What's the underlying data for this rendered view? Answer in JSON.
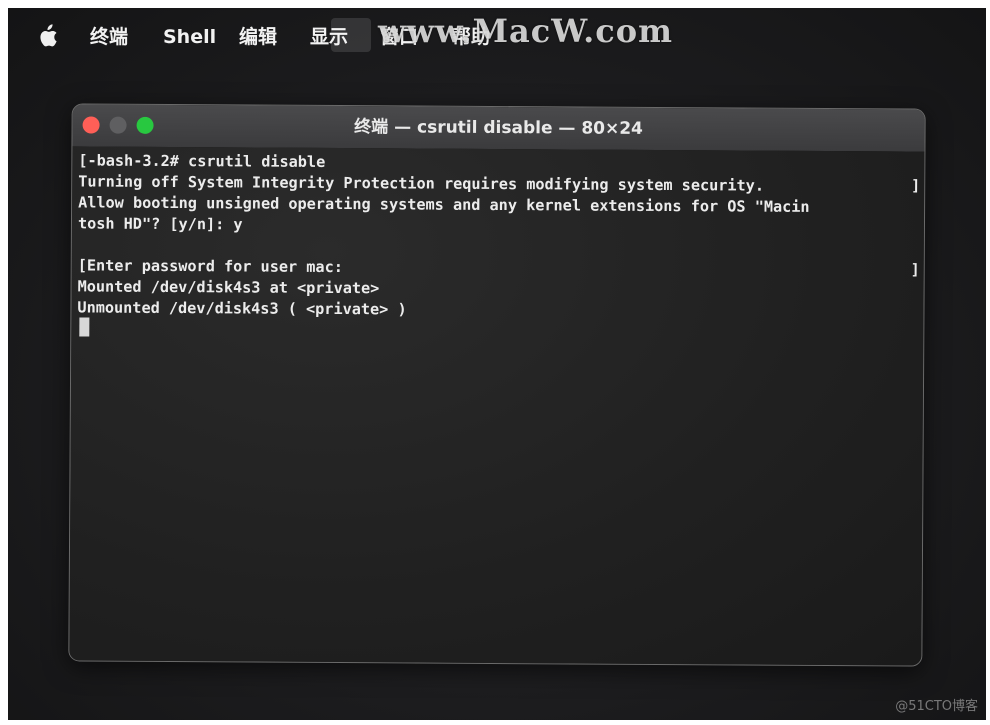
{
  "menubar": {
    "app_name": "终端",
    "items": [
      "Shell",
      "编辑",
      "显示",
      "窗口",
      "帮助"
    ]
  },
  "watermark": {
    "top": "www.MacW.com",
    "bottom": "@51CTO博客"
  },
  "window": {
    "title": "终端 — csrutil disable — 80×24",
    "traffic_lights": {
      "close": "#ff5f57",
      "minimize": "#5f5f61",
      "zoom": "#28c840"
    }
  },
  "terminal": {
    "lines": [
      "[-bash-3.2# csrutil disable",
      "Turning off System Integrity Protection requires modifying system security.",
      "Allow booting unsigned operating systems and any kernel extensions for OS \"Macin",
      "tosh HD\"? [y/n]: y",
      "",
      "[Enter password for user mac:",
      "Mounted /dev/disk4s3 at <private>",
      "Unmounted /dev/disk4s3 ( <private> )"
    ],
    "right_brackets": [
      "]",
      "]"
    ]
  }
}
